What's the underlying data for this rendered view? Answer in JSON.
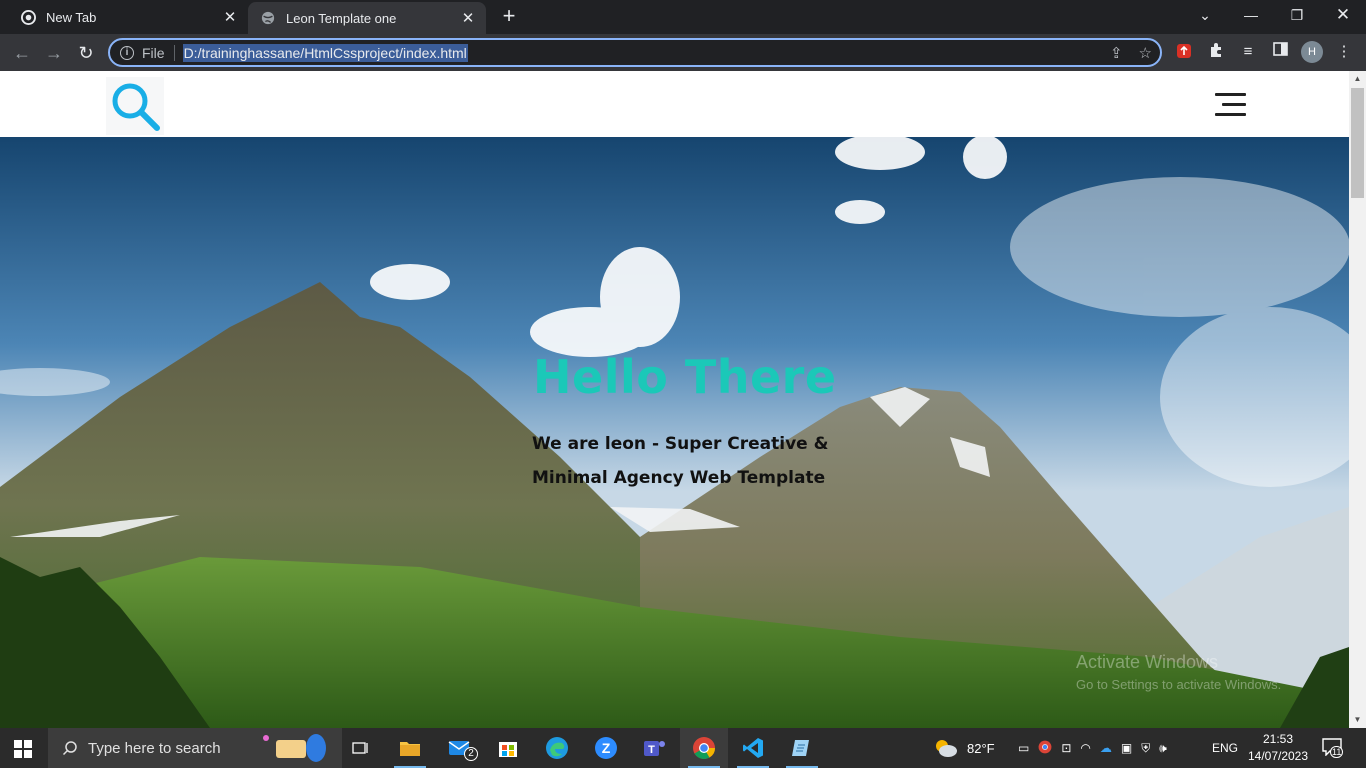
{
  "browser": {
    "tabs": [
      {
        "title": "New Tab",
        "active": false
      },
      {
        "title": "Leon Template one",
        "active": true
      }
    ],
    "omnibox": {
      "scheme_label": "File",
      "url": "D:/traininghassane/HtmlCssproject/index.html"
    },
    "profile_initial": "H"
  },
  "page": {
    "hero": {
      "title": "Hello There",
      "subtitle_line1": "We are leon - Super Creative &",
      "subtitle_line2": "Minimal Agency Web Template",
      "title_color": "#1bc8b8"
    },
    "watermark": {
      "line1": "Activate Windows",
      "line2": "Go to Settings to activate Windows."
    },
    "accent_color": "#19aee6"
  },
  "taskbar": {
    "search_placeholder": "Type here to search",
    "mail_badge": "2",
    "weather": "82°F",
    "language": "ENG",
    "time": "21:53",
    "date": "14/07/2023",
    "notifications": "11"
  }
}
